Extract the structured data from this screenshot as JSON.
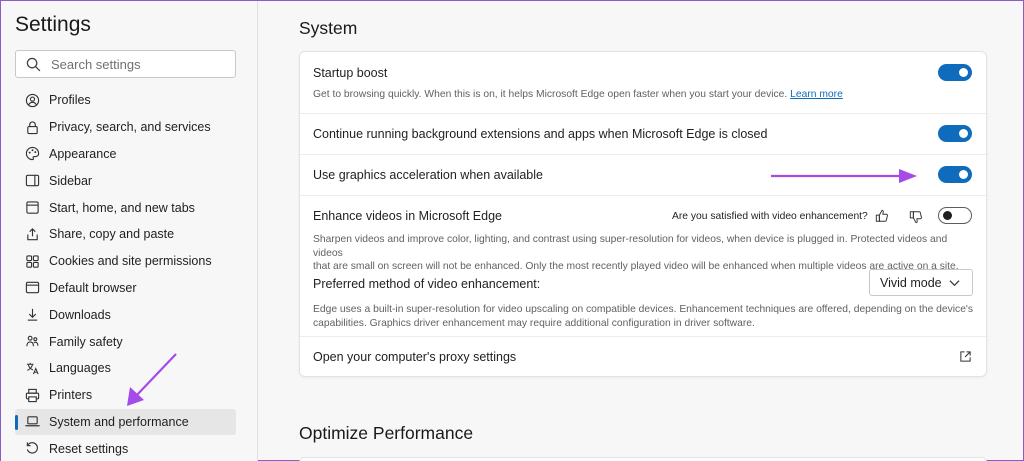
{
  "sidebar": {
    "title": "Settings",
    "search_placeholder": "Search settings",
    "items": [
      {
        "label": "Profiles",
        "icon": "profile-icon"
      },
      {
        "label": "Privacy, search, and services",
        "icon": "lock-icon"
      },
      {
        "label": "Appearance",
        "icon": "palette-icon"
      },
      {
        "label": "Sidebar",
        "icon": "sidebar-icon"
      },
      {
        "label": "Start, home, and new tabs",
        "icon": "home-icon"
      },
      {
        "label": "Share, copy and paste",
        "icon": "share-icon"
      },
      {
        "label": "Cookies and site permissions",
        "icon": "cookie-icon"
      },
      {
        "label": "Default browser",
        "icon": "browser-icon"
      },
      {
        "label": "Downloads",
        "icon": "download-icon"
      },
      {
        "label": "Family safety",
        "icon": "family-icon"
      },
      {
        "label": "Languages",
        "icon": "language-icon"
      },
      {
        "label": "Printers",
        "icon": "printer-icon"
      },
      {
        "label": "System and performance",
        "icon": "laptop-icon"
      },
      {
        "label": "Reset settings",
        "icon": "reset-icon"
      }
    ],
    "active_index": 12
  },
  "system": {
    "title": "System",
    "startup_boost": {
      "title": "Startup boost",
      "desc": "Get to browsing quickly. When this is on, it helps Microsoft Edge open faster when you start your device.",
      "link": "Learn more",
      "enabled": true
    },
    "background_ext": {
      "title": "Continue running background extensions and apps when Microsoft Edge is closed",
      "enabled": true
    },
    "graphics_accel": {
      "title": "Use graphics acceleration when available",
      "enabled": true
    },
    "enhance_videos": {
      "title": "Enhance videos in Microsoft Edge",
      "feedback_question": "Are you satisfied with video enhancement?",
      "desc_line1": "Sharpen videos and improve color, lighting, and contrast using super-resolution for videos, when device is plugged in. Protected videos and videos",
      "desc_line2": "that are small on screen will not be enhanced. Only the most recently played video will be enhanced when multiple videos are active on a site.",
      "enabled": false
    },
    "preferred_method": {
      "title": "Preferred method of video enhancement:",
      "selected": "Vivid mode",
      "desc_line1": "Edge uses a built-in super-resolution for video upscaling on compatible devices. Enhancement techniques are offered, depending on the device's",
      "desc_line2": "capabilities. Graphics driver enhancement may require additional configuration in driver software."
    },
    "proxy": {
      "title": "Open your computer's proxy settings"
    }
  },
  "optimize": {
    "title": "Optimize Performance"
  },
  "colors": {
    "accent": "#0f6cbd",
    "annotation": "#a44be8"
  }
}
